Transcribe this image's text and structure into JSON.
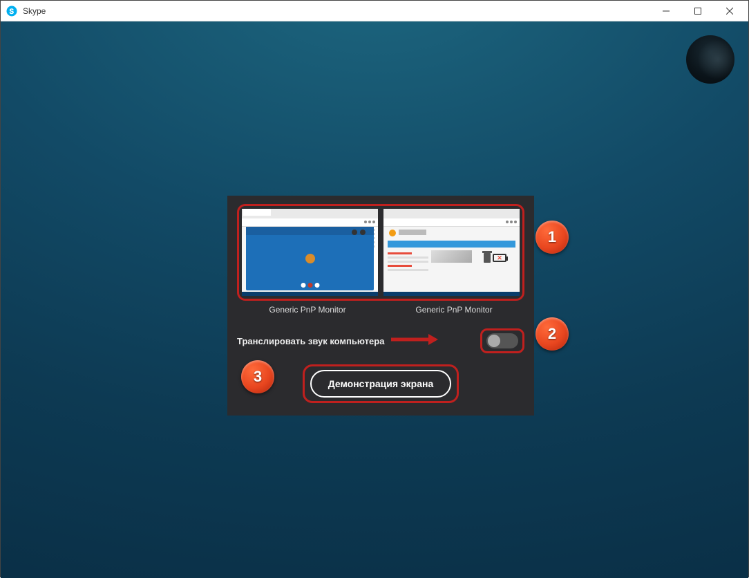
{
  "window": {
    "title": "Skype"
  },
  "dialog": {
    "screens": [
      {
        "label": "Generic PnP Monitor"
      },
      {
        "label": "Generic PnP Monitor"
      }
    ],
    "audio_label": "Транслировать звук компьютера",
    "share_label": "Демонстрация экрана"
  },
  "badges": {
    "b1": "1",
    "b2": "2",
    "b3": "3"
  }
}
